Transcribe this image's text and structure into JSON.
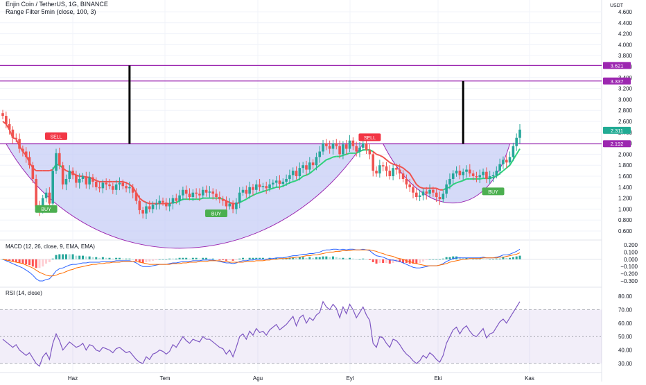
{
  "header": {
    "symbol": "Enjin Coin / TetherUS, 1G, BINANCE",
    "indicator": "Range Filter  5min (close, 100, 3)",
    "currency": "USDT"
  },
  "colors": {
    "purple_line": "#9c27b0",
    "bull": "#26a69a",
    "bear": "#ef5350",
    "price_label": "#22ab94",
    "cup_fill": "#c7cdf5",
    "filter_up": "#2ed17a",
    "filter_down": "#ef5350",
    "macd": "#2962ff",
    "signal": "#ff6d00",
    "rsi": "#7e57c2"
  },
  "chart_data": [
    {
      "type": "candlestick",
      "title": "Enjin Coin / TetherUS, 1G, BINANCE",
      "ylabel": "USDT",
      "ylim": [
        0.5,
        4.8
      ],
      "ytick_labels": [
        "4.600",
        "4.400",
        "4.200",
        "4.000",
        "3.800",
        "3.600",
        "3.400",
        "3.200",
        "3.000",
        "2.800",
        "2.600",
        "2.400",
        "2.200",
        "2.000",
        "1.800",
        "1.600",
        "1.400",
        "1.200",
        "1.000",
        "0.800",
        "0.600"
      ],
      "xtick_labels": [
        "Haz",
        "Tem",
        "Agu",
        "Eyl",
        "Eki",
        "Kas"
      ],
      "close": [
        2.7,
        2.55,
        2.45,
        2.3,
        2.28,
        2.1,
        2.05,
        1.95,
        1.8,
        1.55,
        1.05,
        0.98,
        1.2,
        1.3,
        1.1,
        1.7,
        2.02,
        1.8,
        1.45,
        1.55,
        1.7,
        1.62,
        1.48,
        1.55,
        1.6,
        1.45,
        1.58,
        1.5,
        1.4,
        1.38,
        1.48,
        1.45,
        1.42,
        1.35,
        1.45,
        1.48,
        1.42,
        1.38,
        1.4,
        1.3,
        1.15,
        0.98,
        0.92,
        1.05,
        1.0,
        1.08,
        1.1,
        1.15,
        1.12,
        1.05,
        1.1,
        1.2,
        1.15,
        1.25,
        1.35,
        1.28,
        1.22,
        1.3,
        1.28,
        1.25,
        1.35,
        1.3,
        1.32,
        1.28,
        1.22,
        1.18,
        1.15,
        1.05,
        1.1,
        1.0,
        1.12,
        1.3,
        1.35,
        1.28,
        1.4,
        1.35,
        1.45,
        1.4,
        1.42,
        1.38,
        1.45,
        1.48,
        1.52,
        1.46,
        1.5,
        1.55,
        1.62,
        1.7,
        1.6,
        1.75,
        1.8,
        1.72,
        1.85,
        1.8,
        1.95,
        2.05,
        2.2,
        2.15,
        2.1,
        2.2,
        2.15,
        2.0,
        2.18,
        2.1,
        2.25,
        2.15,
        2.05,
        2.12,
        2.2,
        2.08,
        2.0,
        1.7,
        1.65,
        1.8,
        1.78,
        1.7,
        1.6,
        1.75,
        1.72,
        1.65,
        1.55,
        1.45,
        1.4,
        1.3,
        1.22,
        1.25,
        1.32,
        1.28,
        1.35,
        1.3,
        1.22,
        1.18,
        1.28,
        1.45,
        1.55,
        1.65,
        1.7,
        1.62,
        1.68,
        1.72,
        1.65,
        1.6,
        1.58,
        1.62,
        1.68,
        1.55,
        1.6,
        1.62,
        1.7,
        1.82,
        1.9,
        1.85,
        1.95,
        2.15,
        2.3,
        2.45
      ],
      "range_filter": {
        "values": [
          2.6,
          2.55,
          2.45,
          2.3,
          2.28,
          2.15,
          2.05,
          1.98,
          1.85,
          1.75,
          1.7,
          1.7,
          1.7,
          1.7,
          1.7,
          1.72,
          1.82,
          1.8,
          1.75,
          1.7,
          1.68,
          1.65,
          1.62,
          1.6,
          1.6,
          1.58,
          1.58,
          1.55,
          1.52,
          1.5,
          1.5,
          1.5,
          1.5,
          1.5,
          1.5,
          1.5,
          1.5,
          1.48,
          1.45,
          1.4,
          1.3,
          1.2,
          1.15,
          1.12,
          1.1,
          1.1,
          1.1,
          1.1,
          1.1,
          1.1,
          1.1,
          1.12,
          1.12,
          1.15,
          1.18,
          1.18,
          1.18,
          1.18,
          1.18,
          1.18,
          1.2,
          1.2,
          1.2,
          1.2,
          1.2,
          1.2,
          1.18,
          1.15,
          1.12,
          1.1,
          1.1,
          1.12,
          1.15,
          1.18,
          1.22,
          1.25,
          1.28,
          1.3,
          1.32,
          1.34,
          1.36,
          1.38,
          1.4,
          1.4,
          1.42,
          1.45,
          1.48,
          1.5,
          1.52,
          1.55,
          1.6,
          1.62,
          1.65,
          1.7,
          1.75,
          1.8,
          1.85,
          1.9,
          1.92,
          1.95,
          1.96,
          1.96,
          1.98,
          2.0,
          2.02,
          2.02,
          2.02,
          2.05,
          2.08,
          2.08,
          2.08,
          2.05,
          2.0,
          1.98,
          1.95,
          1.9,
          1.85,
          1.82,
          1.8,
          1.78,
          1.75,
          1.7,
          1.65,
          1.55,
          1.45,
          1.4,
          1.38,
          1.38,
          1.38,
          1.38,
          1.38,
          1.35,
          1.35,
          1.38,
          1.4,
          1.45,
          1.48,
          1.5,
          1.52,
          1.55,
          1.55,
          1.55,
          1.55,
          1.55,
          1.56,
          1.56,
          1.56,
          1.58,
          1.6,
          1.65,
          1.7,
          1.75,
          1.8,
          1.9,
          2.0,
          2.1
        ],
        "direction": [
          "d",
          "d",
          "d",
          "d",
          "d",
          "d",
          "d",
          "d",
          "d",
          "d",
          "d",
          "d",
          "d",
          "d",
          "d",
          "u",
          "u",
          "u",
          "d",
          "d",
          "d",
          "d",
          "d",
          "d",
          "d",
          "d",
          "d",
          "d",
          "d",
          "d",
          "d",
          "d",
          "d",
          "d",
          "d",
          "d",
          "d",
          "d",
          "d",
          "d",
          "d",
          "d",
          "d",
          "d",
          "d",
          "d",
          "d",
          "d",
          "d",
          "d",
          "d",
          "u",
          "u",
          "u",
          "u",
          "u",
          "u",
          "u",
          "u",
          "u",
          "u",
          "u",
          "u",
          "u",
          "u",
          "u",
          "d",
          "d",
          "d",
          "d",
          "d",
          "u",
          "u",
          "u",
          "u",
          "u",
          "u",
          "u",
          "u",
          "u",
          "u",
          "u",
          "u",
          "u",
          "u",
          "u",
          "u",
          "u",
          "u",
          "u",
          "u",
          "u",
          "u",
          "u",
          "u",
          "u",
          "u",
          "u",
          "u",
          "u",
          "u",
          "u",
          "u",
          "u",
          "u",
          "u",
          "u",
          "u",
          "u",
          "u",
          "u",
          "d",
          "d",
          "d",
          "d",
          "d",
          "d",
          "d",
          "d",
          "d",
          "d",
          "d",
          "d",
          "d",
          "d",
          "d",
          "d",
          "d",
          "d",
          "d",
          "d",
          "d",
          "u",
          "u",
          "u",
          "u",
          "u",
          "u",
          "u",
          "u",
          "u",
          "u",
          "u",
          "u",
          "u",
          "u",
          "u",
          "u",
          "u",
          "u",
          "u",
          "u",
          "u",
          "u",
          "u",
          "u"
        ]
      },
      "horizontal_levels": [
        {
          "value": 3.621,
          "label": "3.621"
        },
        {
          "value": 3.337,
          "label": "3.337"
        },
        {
          "value": 2.192,
          "label": "2.192"
        }
      ],
      "last_price_label": "2.311",
      "signals": [
        {
          "type": "sell",
          "label": "SELL",
          "index": 16
        },
        {
          "type": "buy",
          "label": "BUY",
          "index": 13
        },
        {
          "type": "buy",
          "label": "BUY",
          "index": 64
        },
        {
          "type": "sell",
          "label": "SELL",
          "index": 110
        },
        {
          "type": "buy",
          "label": "BUY",
          "index": 147
        }
      ],
      "pattern": "cup and handle"
    },
    {
      "type": "line+bar",
      "title": "MACD (12, 26, close, 9, EMA, EMA)",
      "ylim": [
        -0.35,
        0.25
      ],
      "ytick_labels": [
        "0.200",
        "0.100",
        "0.000",
        "−0.100",
        "−0.200",
        "−0.300"
      ],
      "macd": [
        0.0,
        -0.02,
        -0.04,
        -0.06,
        -0.08,
        -0.1,
        -0.12,
        -0.15,
        -0.18,
        -0.22,
        -0.27,
        -0.3,
        -0.3,
        -0.28,
        -0.27,
        -0.22,
        -0.16,
        -0.13,
        -0.12,
        -0.1,
        -0.08,
        -0.07,
        -0.07,
        -0.06,
        -0.05,
        -0.05,
        -0.04,
        -0.04,
        -0.04,
        -0.04,
        -0.03,
        -0.03,
        -0.03,
        -0.03,
        -0.02,
        -0.02,
        -0.02,
        -0.02,
        -0.02,
        -0.03,
        -0.05,
        -0.08,
        -0.1,
        -0.1,
        -0.1,
        -0.09,
        -0.08,
        -0.07,
        -0.07,
        -0.07,
        -0.06,
        -0.05,
        -0.05,
        -0.04,
        -0.03,
        -0.03,
        -0.03,
        -0.02,
        -0.02,
        -0.02,
        -0.01,
        -0.01,
        -0.01,
        -0.01,
        -0.02,
        -0.03,
        -0.04,
        -0.05,
        -0.05,
        -0.06,
        -0.05,
        -0.03,
        -0.02,
        -0.02,
        -0.01,
        -0.01,
        0.0,
        0.0,
        0.0,
        0.0,
        0.01,
        0.01,
        0.02,
        0.02,
        0.02,
        0.03,
        0.04,
        0.05,
        0.05,
        0.06,
        0.07,
        0.07,
        0.08,
        0.08,
        0.09,
        0.1,
        0.12,
        0.13,
        0.13,
        0.14,
        0.14,
        0.13,
        0.14,
        0.13,
        0.14,
        0.14,
        0.13,
        0.13,
        0.14,
        0.13,
        0.12,
        0.08,
        0.05,
        0.04,
        0.03,
        0.01,
        -0.01,
        -0.01,
        -0.02,
        -0.03,
        -0.05,
        -0.07,
        -0.09,
        -0.11,
        -0.12,
        -0.12,
        -0.11,
        -0.1,
        -0.09,
        -0.09,
        -0.09,
        -0.08,
        -0.06,
        -0.03,
        -0.01,
        0.01,
        0.02,
        0.02,
        0.02,
        0.02,
        0.02,
        0.02,
        0.02,
        0.02,
        0.03,
        0.02,
        0.02,
        0.02,
        0.03,
        0.04,
        0.06,
        0.06,
        0.07,
        0.09,
        0.11,
        0.14
      ],
      "signal": [
        0.0,
        -0.01,
        -0.02,
        -0.03,
        -0.04,
        -0.05,
        -0.06,
        -0.08,
        -0.1,
        -0.12,
        -0.15,
        -0.18,
        -0.2,
        -0.22,
        -0.23,
        -0.23,
        -0.22,
        -0.2,
        -0.19,
        -0.17,
        -0.15,
        -0.14,
        -0.12,
        -0.11,
        -0.1,
        -0.09,
        -0.08,
        -0.07,
        -0.07,
        -0.06,
        -0.06,
        -0.05,
        -0.05,
        -0.04,
        -0.04,
        -0.04,
        -0.03,
        -0.03,
        -0.03,
        -0.03,
        -0.03,
        -0.04,
        -0.05,
        -0.06,
        -0.07,
        -0.07,
        -0.07,
        -0.07,
        -0.07,
        -0.07,
        -0.07,
        -0.06,
        -0.06,
        -0.06,
        -0.05,
        -0.05,
        -0.04,
        -0.04,
        -0.04,
        -0.03,
        -0.03,
        -0.03,
        -0.02,
        -0.02,
        -0.02,
        -0.02,
        -0.03,
        -0.03,
        -0.04,
        -0.04,
        -0.04,
        -0.04,
        -0.04,
        -0.03,
        -0.03,
        -0.03,
        -0.02,
        -0.02,
        -0.02,
        -0.01,
        -0.01,
        0.0,
        0.0,
        0.01,
        0.01,
        0.01,
        0.02,
        0.02,
        0.03,
        0.03,
        0.04,
        0.05,
        0.05,
        0.06,
        0.06,
        0.07,
        0.08,
        0.09,
        0.1,
        0.1,
        0.11,
        0.11,
        0.12,
        0.12,
        0.12,
        0.13,
        0.13,
        0.13,
        0.13,
        0.13,
        0.13,
        0.12,
        0.11,
        0.09,
        0.08,
        0.06,
        0.05,
        0.04,
        0.02,
        0.01,
        0.0,
        -0.02,
        -0.03,
        -0.05,
        -0.06,
        -0.07,
        -0.08,
        -0.09,
        -0.09,
        -0.09,
        -0.09,
        -0.08,
        -0.07,
        -0.06,
        -0.04,
        -0.03,
        -0.02,
        -0.01,
        0.0,
        0.0,
        0.01,
        0.01,
        0.01,
        0.01,
        0.02,
        0.02,
        0.02,
        0.02,
        0.02,
        0.03,
        0.03,
        0.04,
        0.05,
        0.06,
        0.07,
        0.09
      ]
    },
    {
      "type": "line",
      "title": "RSI (14, close)",
      "ylim": [
        25,
        85
      ],
      "band": [
        30,
        70
      ],
      "ytick_labels": [
        "80.00",
        "70.00",
        "60.00",
        "50.00",
        "40.00",
        "30.00"
      ],
      "rsi": [
        48,
        46,
        44,
        42,
        44,
        40,
        38,
        36,
        38,
        34,
        30,
        28,
        35,
        38,
        33,
        45,
        52,
        47,
        40,
        43,
        46,
        44,
        42,
        43,
        45,
        40,
        44,
        43,
        40,
        39,
        42,
        41,
        40,
        38,
        41,
        42,
        40,
        38,
        39,
        36,
        33,
        31,
        30,
        35,
        33,
        37,
        38,
        40,
        39,
        37,
        39,
        44,
        42,
        46,
        50,
        47,
        45,
        48,
        47,
        46,
        50,
        48,
        48,
        46,
        44,
        42,
        41,
        37,
        40,
        35,
        42,
        50,
        52,
        48,
        54,
        51,
        56,
        53,
        54,
        51,
        55,
        57,
        59,
        55,
        57,
        59,
        62,
        65,
        58,
        64,
        66,
        60,
        64,
        62,
        66,
        68,
        76,
        72,
        70,
        74,
        71,
        64,
        72,
        67,
        74,
        70,
        64,
        68,
        72,
        66,
        62,
        45,
        42,
        50,
        49,
        45,
        42,
        48,
        47,
        44,
        40,
        37,
        35,
        32,
        30,
        32,
        36,
        34,
        38,
        36,
        33,
        31,
        36,
        45,
        50,
        55,
        57,
        52,
        56,
        58,
        54,
        51,
        50,
        53,
        56,
        49,
        52,
        53,
        57,
        61,
        63,
        60,
        64,
        68,
        72,
        76
      ]
    }
  ]
}
